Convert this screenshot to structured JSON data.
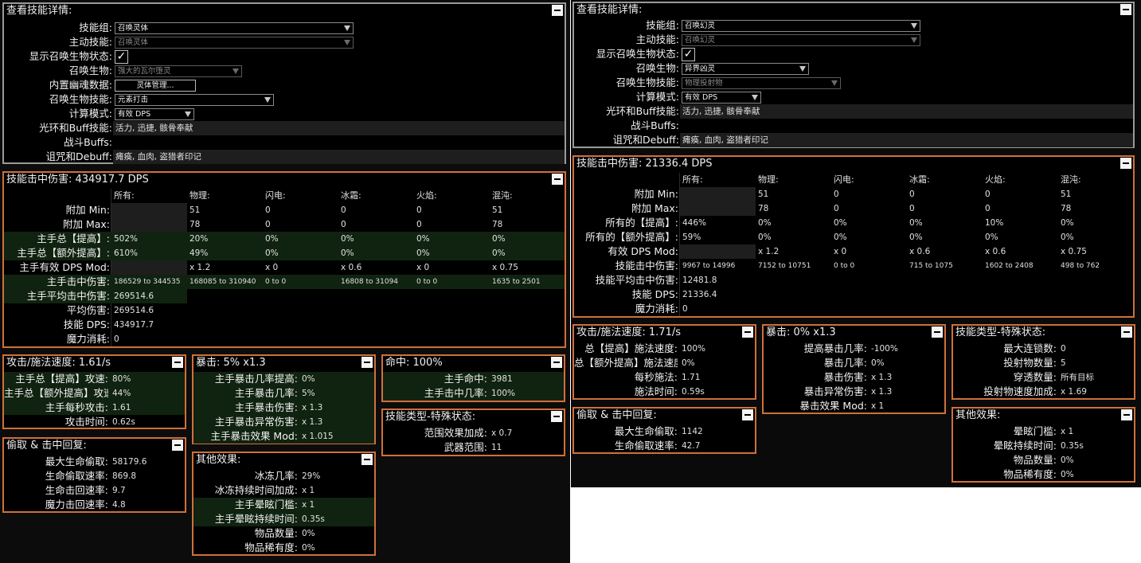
{
  "left": {
    "details": {
      "title": "查看技能详情:",
      "skill_group_label": "技能组:",
      "skill_group_value": "召唤灵体",
      "active_skill_label": "主动技能:",
      "active_skill_value": "召唤灵体",
      "show_minion_label": "显示召唤生物状态:",
      "show_minion_check": "✓",
      "minion_label": "召唤生物:",
      "minion_value": "强大的瓦尔堕灵",
      "spectre_label": "内置幽魂数据:",
      "spectre_button": "灵体管理...",
      "minion_skill_label": "召唤生物技能:",
      "minion_skill_value": "元素打击",
      "calc_mode_label": "计算模式:",
      "calc_mode_value": "有效 DPS",
      "aura_label": "光环和Buff技能:",
      "aura_value": "活力, 迅捷, 骸骨奉献",
      "combat_label": "战斗Buffs:",
      "combat_value": "",
      "curse_label": "诅咒和Debuff:",
      "curse_value": "瘫痪, 血肉, 盗猎者印记"
    },
    "hit": {
      "title": "技能击中伤害: 434917.7 DPS",
      "columns": [
        "所有:",
        "物理:",
        "闪电:",
        "冰霜:",
        "火焰:",
        "混沌:"
      ],
      "rows": [
        {
          "label": "附加 Min:",
          "values": [
            "",
            "51",
            "0",
            "0",
            "0",
            "51"
          ]
        },
        {
          "label": "附加 Max:",
          "values": [
            "",
            "78",
            "0",
            "0",
            "0",
            "78"
          ]
        },
        {
          "label": "主手总【提高】:",
          "values": [
            "502%",
            "20%",
            "0%",
            "0%",
            "0%",
            "0%"
          ]
        },
        {
          "label": "主手总【额外提高】:",
          "values": [
            "610%",
            "49%",
            "0%",
            "0%",
            "0%",
            "0%"
          ]
        },
        {
          "label": "主手有效 DPS Mod:",
          "values": [
            "",
            "x 1.2",
            "x 0",
            "x 0.6",
            "x 0",
            "x 0.75"
          ]
        },
        {
          "label": "主手击中伤害:",
          "values": [
            "186529 to 344535",
            "168085 to 310940",
            "0 to 0",
            "16808 to 31094",
            "0 to 0",
            "1635 to 2501"
          ]
        },
        {
          "label": "主手平均击中伤害:",
          "values": [
            "269514.6"
          ]
        },
        {
          "label": "平均伤害:",
          "values": [
            "269514.6"
          ]
        },
        {
          "label": "技能 DPS:",
          "values": [
            "434917.7"
          ]
        },
        {
          "label": "魔力消耗:",
          "values": [
            "0"
          ]
        }
      ]
    },
    "speed": {
      "title": "攻击/施法速度: 1.61/s",
      "rows": [
        {
          "label": "主手总【提高】攻速:",
          "value": "80%"
        },
        {
          "label": "主手总【额外提高】攻速:",
          "value": "44%"
        },
        {
          "label": "主手每秒攻击:",
          "value": "1.61"
        },
        {
          "label": "攻击时间:",
          "value": "0.62s"
        }
      ]
    },
    "crit": {
      "title": "暴击: 5% x1.3",
      "rows": [
        {
          "label": "主手暴击几率提高:",
          "value": "0%"
        },
        {
          "label": "主手暴击几率:",
          "value": "5%"
        },
        {
          "label": "主手暴击伤害:",
          "value": "x 1.3"
        },
        {
          "label": "主手暴击异常伤害:",
          "value": "x 1.3"
        },
        {
          "label": "主手暴击效果 Mod:",
          "value": "x 1.015"
        }
      ]
    },
    "accuracy": {
      "title": "命中: 100%",
      "rows": [
        {
          "label": "主手命中:",
          "value": "3981"
        },
        {
          "label": "主手击中几率:",
          "value": "100%"
        }
      ]
    },
    "skilltype": {
      "title": "技能类型-特殊状态:",
      "rows": [
        {
          "label": "范围效果加成:",
          "value": "x 0.7"
        },
        {
          "label": "武器范围:",
          "value": "11"
        }
      ]
    },
    "leech": {
      "title": "偷取 & 击中回复:",
      "rows": [
        {
          "label": "最大生命偷取:",
          "value": "58179.6"
        },
        {
          "label": "生命偷取速率:",
          "value": "869.8"
        },
        {
          "label": "生命击回速率:",
          "value": "9.7"
        },
        {
          "label": "魔力击回速率:",
          "value": "4.8"
        }
      ]
    },
    "other": {
      "title": "其他效果:",
      "rows": [
        {
          "label": "冰冻几率:",
          "value": "29%"
        },
        {
          "label": "冰冻持续时间加成:",
          "value": "x 1"
        },
        {
          "label": "主手晕眩门槛:",
          "value": "x 1"
        },
        {
          "label": "主手晕眩持续时间:",
          "value": "0.35s"
        },
        {
          "label": "物品数量:",
          "value": "0%"
        },
        {
          "label": "物品稀有度:",
          "value": "0%"
        }
      ]
    }
  },
  "right": {
    "details": {
      "title": "查看技能详情:",
      "skill_group_label": "技能组:",
      "skill_group_value": "召唤幻灵",
      "active_skill_label": "主动技能:",
      "active_skill_value": "召唤幻灵",
      "show_minion_label": "显示召唤生物状态:",
      "show_minion_check": "✓",
      "minion_label": "召唤生物:",
      "minion_value": "异界凶灵",
      "minion_skill_label": "召唤生物技能:",
      "minion_skill_value": "物理投射物",
      "calc_mode_label": "计算模式:",
      "calc_mode_value": "有效 DPS",
      "aura_label": "光环和Buff技能:",
      "aura_value": "活力, 迅捷, 骸骨奉献",
      "combat_label": "战斗Buffs:",
      "combat_value": "",
      "curse_label": "诅咒和Debuff:",
      "curse_value": "瘫痪, 血肉, 盗猎者印记"
    },
    "hit": {
      "title": "技能击中伤害: 21336.4 DPS",
      "columns": [
        "所有:",
        "物理:",
        "闪电:",
        "冰霜:",
        "火焰:",
        "混沌:"
      ],
      "rows": [
        {
          "label": "附加 Min:",
          "values": [
            "",
            "51",
            "0",
            "0",
            "0",
            "51"
          ]
        },
        {
          "label": "附加 Max:",
          "values": [
            "",
            "78",
            "0",
            "0",
            "0",
            "78"
          ]
        },
        {
          "label": "所有的【提高】:",
          "values": [
            "446%",
            "0%",
            "0%",
            "0%",
            "10%",
            "0%"
          ]
        },
        {
          "label": "所有的【额外提高】:",
          "values": [
            "59%",
            "0%",
            "0%",
            "0%",
            "0%",
            "0%"
          ]
        },
        {
          "label": "有效 DPS Mod:",
          "values": [
            "",
            "x 1.2",
            "x 0",
            "x 0.6",
            "x 0.6",
            "x 0.75"
          ]
        },
        {
          "label": "技能击中伤害:",
          "values": [
            "9967 to 14996",
            "7152 to 10751",
            "0 to 0",
            "715 to 1075",
            "1602 to 2408",
            "498 to 762"
          ]
        },
        {
          "label": "技能平均击中伤害:",
          "values": [
            "12481.8"
          ]
        },
        {
          "label": "技能 DPS:",
          "values": [
            "21336.4"
          ]
        },
        {
          "label": "魔力消耗:",
          "values": [
            "0"
          ]
        }
      ]
    },
    "speed": {
      "title": "攻击/施法速度: 1.71/s",
      "rows": [
        {
          "label": "总【提高】施法速度:",
          "value": "100%"
        },
        {
          "label": "总【额外提高】施法速度:",
          "value": "0%"
        },
        {
          "label": "每秒施法:",
          "value": "1.71"
        },
        {
          "label": "施法时间:",
          "value": "0.59s"
        }
      ]
    },
    "crit": {
      "title": "暴击: 0% x1.3",
      "rows": [
        {
          "label": "提高暴击几率:",
          "value": "-100%"
        },
        {
          "label": "暴击几率:",
          "value": "0%"
        },
        {
          "label": "暴击伤害:",
          "value": "x 1.3"
        },
        {
          "label": "暴击异常伤害:",
          "value": "x 1.3"
        },
        {
          "label": "暴击效果 Mod:",
          "value": "x 1"
        }
      ]
    },
    "skilltype": {
      "title": "技能类型-特殊状态:",
      "rows": [
        {
          "label": "最大连锁数:",
          "value": "0"
        },
        {
          "label": "投射物数量:",
          "value": "5"
        },
        {
          "label": "穿透数量:",
          "value": "所有目标"
        },
        {
          "label": "投射物速度加成:",
          "value": "x 1.69"
        }
      ]
    },
    "leech": {
      "title": "偷取 & 击中回复:",
      "rows": [
        {
          "label": "最大生命偷取:",
          "value": "1142"
        },
        {
          "label": "生命偷取速率:",
          "value": "42.7"
        }
      ]
    },
    "other": {
      "title": "其他效果:",
      "rows": [
        {
          "label": "晕眩门槛:",
          "value": "x 1"
        },
        {
          "label": "晕眩持续时间:",
          "value": "0.35s"
        },
        {
          "label": "物品数量:",
          "value": "0%"
        },
        {
          "label": "物品稀有度:",
          "value": "0%"
        }
      ]
    }
  }
}
